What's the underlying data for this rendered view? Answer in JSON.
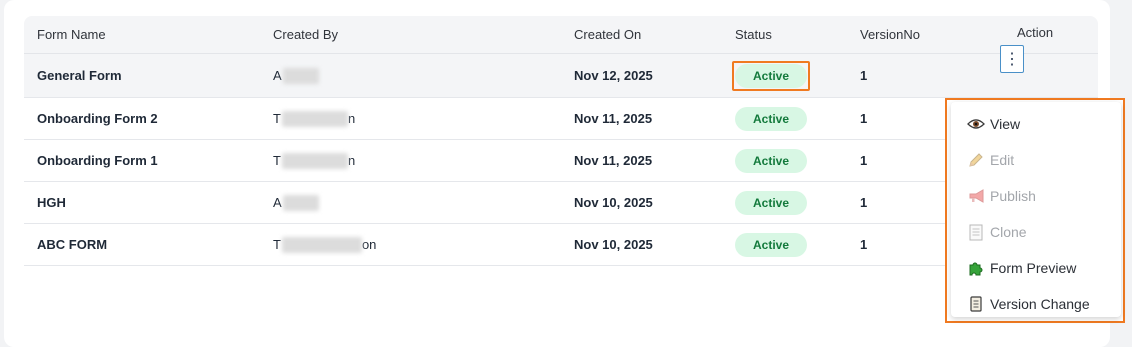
{
  "columns": [
    "Form Name",
    "Created By",
    "Created On",
    "Status",
    "VersionNo",
    "Action"
  ],
  "rows": [
    {
      "name": "General Form",
      "created_by_visible": "A",
      "created_by_suffix": "",
      "created_on": "Nov 12, 2025",
      "status": "Active",
      "version": "1"
    },
    {
      "name": "Onboarding Form 2",
      "created_by_visible": "T",
      "created_by_suffix": "n",
      "created_on": "Nov 11, 2025",
      "status": "Active",
      "version": "1"
    },
    {
      "name": "Onboarding Form 1",
      "created_by_visible": "T",
      "created_by_suffix": "n",
      "created_on": "Nov 11, 2025",
      "status": "Active",
      "version": "1"
    },
    {
      "name": "HGH",
      "created_by_visible": "A",
      "created_by_suffix": "",
      "created_on": "Nov 10, 2025",
      "status": "Active",
      "version": "1"
    },
    {
      "name": "ABC FORM",
      "created_by_visible": "T",
      "created_by_suffix": "on",
      "created_on": "Nov 10, 2025",
      "status": "Active",
      "version": "1"
    }
  ],
  "action_button": {
    "icon": "kebab-menu-icon",
    "glyph": "⋮"
  },
  "menu": {
    "items": [
      {
        "label": "View",
        "icon": "eye-icon",
        "disabled": false
      },
      {
        "label": "Edit",
        "icon": "pencil-icon",
        "disabled": true
      },
      {
        "label": "Publish",
        "icon": "megaphone-icon",
        "disabled": true
      },
      {
        "label": "Clone",
        "icon": "document-icon",
        "disabled": true
      },
      {
        "label": "Form Preview",
        "icon": "puzzle-icon",
        "disabled": false
      },
      {
        "label": "Version Change",
        "icon": "scroll-icon",
        "disabled": false
      }
    ]
  },
  "colors": {
    "highlight_outline": "#f07a21",
    "badge_bg": "#d8f7e4",
    "badge_text": "#137a3c"
  }
}
